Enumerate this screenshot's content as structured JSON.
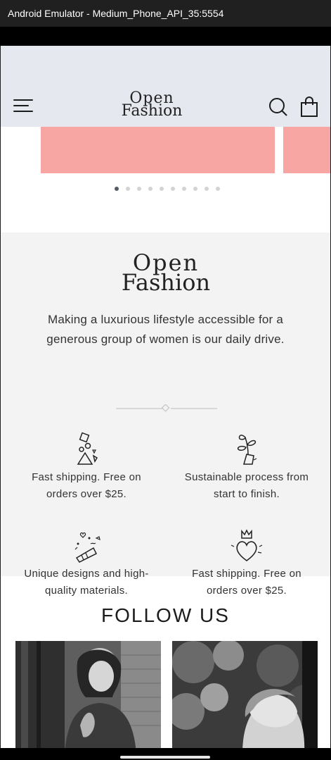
{
  "window": {
    "title": "Android Emulator - Medium_Phone_API_35:5554"
  },
  "header": {
    "brand_line1": "Open",
    "brand_line2": "Fashion",
    "menu_icon": "hamburger-icon",
    "search_icon": "search-icon",
    "cart_icon": "shopping-bag-icon"
  },
  "carousel": {
    "slide_count": 10,
    "active_index": 0,
    "banner_color": "#f7a6a4"
  },
  "about": {
    "brand_line1": "Open",
    "brand_line2": "Fashion",
    "tagline": "Making a luxurious lifestyle accessible for a generous group of women is our daily drive.",
    "features": [
      {
        "icon": "shapes-icon",
        "text": "Fast shipping. Free on orders over $25."
      },
      {
        "icon": "plant-pot-icon",
        "text": "Sustainable process from start to finish."
      },
      {
        "icon": "party-popper-icon",
        "text": "Unique designs and high-quality materials."
      },
      {
        "icon": "crowned-heart-icon",
        "text": "Fast shipping. Free on orders over $25."
      }
    ]
  },
  "follow": {
    "title": "FOLLOW US"
  },
  "colors": {
    "header_bg": "#e5e8ee",
    "section_bg": "#f3f3f3",
    "accent": "#f7a6a4"
  }
}
